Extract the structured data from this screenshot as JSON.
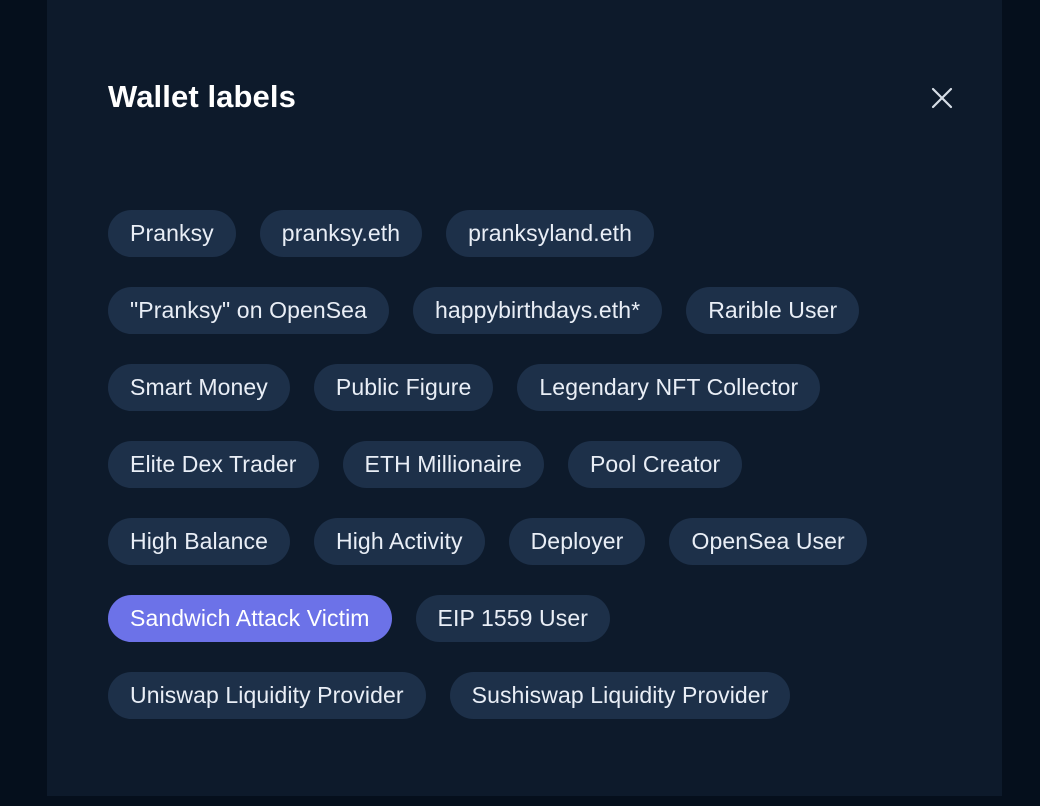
{
  "colors": {
    "backdrop": "#050f1c",
    "panel_bg": "#0d1a2b",
    "chip_bg": "#1d3049",
    "chip_text": "#e9eef6",
    "highlight_bg": "#6c72e8",
    "highlight_text": "#ffffff",
    "title_text": "#ffffff",
    "close_icon": "#d6dde6"
  },
  "modal": {
    "title": "Wallet labels",
    "close_icon_name": "close-icon"
  },
  "labels": {
    "rows": [
      {
        "chips": [
          {
            "text": "Pranksy",
            "highlighted": false
          },
          {
            "text": "pranksy.eth",
            "highlighted": false
          },
          {
            "text": "pranksyland.eth",
            "highlighted": false
          }
        ]
      },
      {
        "chips": [
          {
            "text": "\"Pranksy\" on OpenSea",
            "highlighted": false
          },
          {
            "text": "happybirthdays.eth*",
            "highlighted": false
          },
          {
            "text": "Rarible User",
            "highlighted": false
          }
        ]
      },
      {
        "chips": [
          {
            "text": "Smart Money",
            "highlighted": false
          },
          {
            "text": "Public Figure",
            "highlighted": false
          },
          {
            "text": "Legendary NFT Collector",
            "highlighted": false
          }
        ]
      },
      {
        "chips": [
          {
            "text": "Elite Dex Trader",
            "highlighted": false
          },
          {
            "text": "ETH Millionaire",
            "highlighted": false
          },
          {
            "text": "Pool Creator",
            "highlighted": false
          }
        ]
      },
      {
        "chips": [
          {
            "text": "High Balance",
            "highlighted": false
          },
          {
            "text": "High Activity",
            "highlighted": false
          },
          {
            "text": "Deployer",
            "highlighted": false
          },
          {
            "text": "OpenSea User",
            "highlighted": false
          }
        ]
      },
      {
        "chips": [
          {
            "text": "Sandwich Attack Victim",
            "highlighted": true
          },
          {
            "text": "EIP 1559 User",
            "highlighted": false
          }
        ]
      },
      {
        "chips": [
          {
            "text": "Uniswap Liquidity Provider",
            "highlighted": false
          },
          {
            "text": "Sushiswap Liquidity Provider",
            "highlighted": false
          }
        ]
      }
    ]
  }
}
